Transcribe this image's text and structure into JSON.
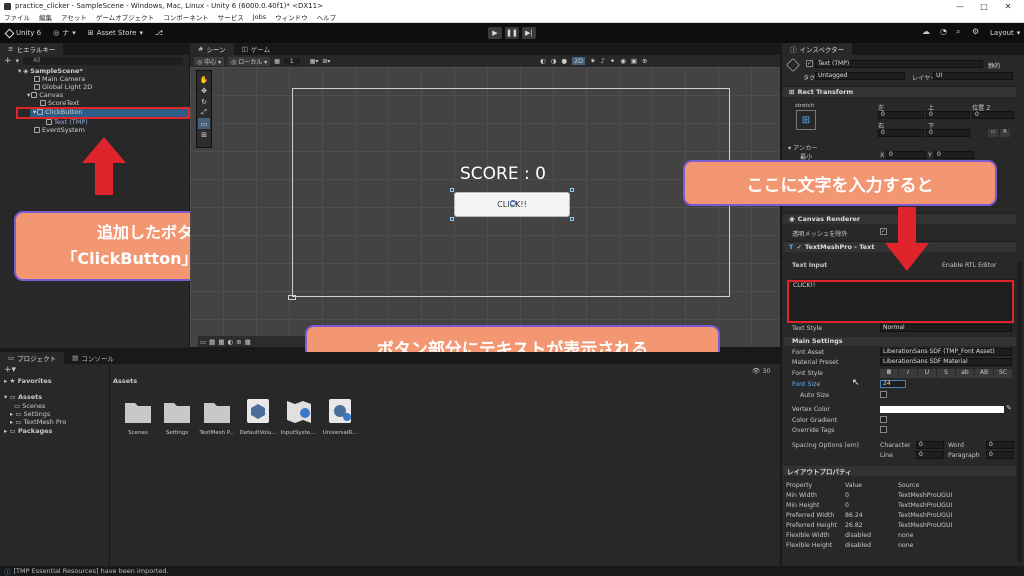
{
  "window": {
    "title": "practice_clicker - SampleScene - Windows, Mac, Linux - Unity 6 (6000.0.40f1)* <DX11>",
    "controls": [
      "—",
      "□",
      "✕"
    ]
  },
  "menu": [
    "ファイル",
    "編集",
    "アセット",
    "ゲームオブジェクト",
    "コンポーネント",
    "サービス",
    "Jobs",
    "ウィンドウ",
    "ヘルプ"
  ],
  "toolbar": {
    "unity_label": "Unity 6",
    "account_label": "ナ",
    "asset_store_label": "Asset Store",
    "layout_label": "Layout"
  },
  "hierarchy": {
    "tab_label": "ヒエラルキー",
    "search_placeholder": "All",
    "items": [
      {
        "label": "SampleScene*"
      },
      {
        "label": "Main Camera"
      },
      {
        "label": "Global Light 2D"
      },
      {
        "label": "Canvas"
      },
      {
        "label": "ScoreText"
      },
      {
        "label": "ClickButton"
      },
      {
        "label": "Text (TMP)"
      },
      {
        "label": "EventSystem"
      }
    ]
  },
  "scene": {
    "tab_scene": "シーン",
    "tab_game": "ゲーム",
    "pivot_label": "中心",
    "space_label": "ローカル",
    "snap_value": "1",
    "mode_2d": "2D",
    "score_text": "SCORE : 0",
    "button_text": "CLICK!!"
  },
  "inspector": {
    "tab_label": "インスペクター",
    "object_name": "Text (TMP)",
    "static_label": "静的",
    "tag_label": "タグ",
    "tag_value": "Untagged",
    "layer_label": "レイヤー",
    "layer_value": "UI",
    "rect_transform": "Rect Transform",
    "stretch_label": "stretch",
    "col_left": "左",
    "col_top": "上",
    "col_posz": "位置 Z",
    "col_right": "右",
    "col_bottom": "下",
    "v_left": "0",
    "v_top": "0",
    "v_posz": "0",
    "v_right": "0",
    "v_bottom": "0",
    "anchor_label": "アンカー",
    "min_label": "最小",
    "min_x": "0",
    "min_y": "0",
    "canvas_renderer": "Canvas Renderer",
    "cull_label": "透明メッシュを除外",
    "tmp_label": "TextMeshPro - Text",
    "text_input_label": "Text Input",
    "enable_rtl": "Enable RTL Editor",
    "text_input_value": "CLICK!!",
    "text_style_label": "Text Style",
    "text_style_value": "Normal",
    "main_settings": "Main Settings",
    "font_asset_label": "Font Asset",
    "font_asset_value": "LiberationSans SDF (TMP_Font Asset)",
    "material_preset_label": "Material Preset",
    "material_preset_value": "LiberationSans SDF Material",
    "font_style_label": "Font Style",
    "font_style_buttons": [
      "B",
      "I",
      "U",
      "S",
      "ab",
      "AB",
      "SC"
    ],
    "font_size_label": "Font Size",
    "font_size_value": "24",
    "auto_size_label": "Auto Size",
    "vertex_color_label": "Vertex Color",
    "color_gradient_label": "Color Gradient",
    "override_tags_label": "Override Tags",
    "spacing_label": "Spacing Options (em)",
    "character_label": "Character",
    "character_value": "0",
    "word_label": "Word",
    "word_value": "0",
    "line_label": "Line",
    "line_value": "0",
    "paragraph_label": "Paragraph",
    "paragraph_value": "0",
    "layout_props_title": "レイアウトプロパティ",
    "layout_headers": [
      "Property",
      "Value",
      "Source"
    ],
    "layout_rows": [
      [
        "Min Width",
        "0",
        "TextMeshProUGUI"
      ],
      [
        "Min Height",
        "0",
        "TextMeshProUGUI"
      ],
      [
        "Preferred Width",
        "86.24",
        "TextMeshProUGUI"
      ],
      [
        "Preferred Height",
        "26.82",
        "TextMeshProUGUI"
      ],
      [
        "Flexible Width",
        "disabled",
        "none"
      ],
      [
        "Flexible Height",
        "disabled",
        "none"
      ]
    ]
  },
  "project": {
    "tab_project": "プロジェクト",
    "tab_console": "コンソール",
    "favorites": "Favorites",
    "assets": "Assets",
    "assets_children": [
      "Scenes",
      "Settings",
      "TextMesh Pro"
    ],
    "packages": "Packages",
    "breadcrumb": "Assets",
    "count_label": "30",
    "grid_items": [
      {
        "label": "Scenes",
        "icon": "folder-icon"
      },
      {
        "label": "Settings",
        "icon": "folder-icon"
      },
      {
        "label": "TextMesh P...",
        "icon": "folder-icon"
      },
      {
        "label": "DefaultVolu...",
        "icon": "volume-asset-icon"
      },
      {
        "label": "InputSyste...",
        "icon": "input-actions-icon"
      },
      {
        "label": "UniversalR...",
        "icon": "render-pipeline-icon"
      }
    ]
  },
  "status": {
    "message": "[TMP Essential Resources] have been imported."
  },
  "annotations": {
    "hierarchy_note": [
      "追加したボタンの名前を",
      "「ClickButton」に変更しておく"
    ],
    "scene_note": "ボタン部分にテキストが表示される",
    "inspector_note": "ここに文字を入力すると"
  },
  "colors": {
    "callout_fill": "#f39773",
    "callout_border": "#7d5bd3",
    "highlight_red": "#e0242b",
    "selection_blue": "#2c5d87"
  }
}
